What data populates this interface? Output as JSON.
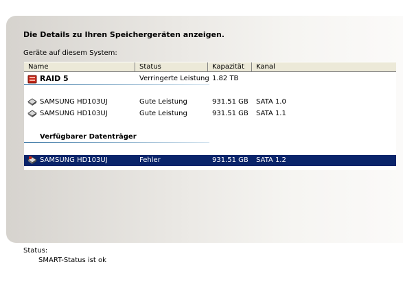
{
  "heading": "Die Details zu Ihren Speichergeräten anzeigen.",
  "devices_label": "Geräte auf diesem System:",
  "columns": [
    "Name",
    "Status",
    "Kapazität",
    "Kanal"
  ],
  "raid": {
    "icon": "raid-array-icon",
    "name": "RAID 5",
    "status": "Verringerte Leistung",
    "capacity": "1.82 TB",
    "channel": ""
  },
  "disks": [
    {
      "icon": "hard-disk-icon",
      "name": "SAMSUNG HD103UJ",
      "status": "Gute Leistung",
      "capacity": "931.51 GB",
      "channel": "SATA 1.0"
    },
    {
      "icon": "hard-disk-icon",
      "name": "SAMSUNG HD103UJ",
      "status": "Gute Leistung",
      "capacity": "931.51 GB",
      "channel": "SATA 1.1"
    }
  ],
  "available_group_title": "Verfügbarer Datenträger",
  "available": [
    {
      "icon": "hard-disk-error-icon",
      "name": "SAMSUNG HD103UJ",
      "status": "Fehler",
      "capacity": "931.51 GB",
      "channel": "SATA 1.2"
    }
  ],
  "status_label": "Status:",
  "status_value": "SMART-Status ist ok",
  "colors": {
    "selection": "#0a246a",
    "raid_icon": "#c62a1c",
    "header_bg": "#ece9d8"
  }
}
